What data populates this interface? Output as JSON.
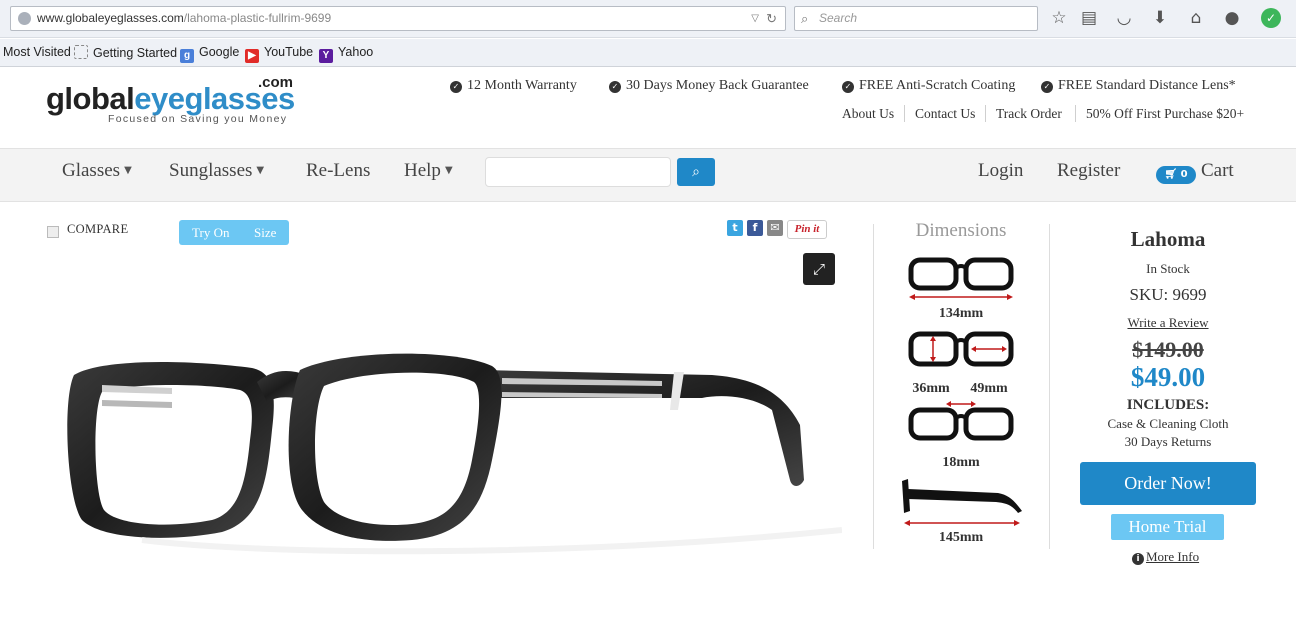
{
  "browser": {
    "url_host": "www.globaleyeglasses.com",
    "url_path": "/lahoma-plastic-fullrim-9699",
    "search_placeholder": "Search",
    "bookmarks": [
      {
        "label": "Most Visited",
        "icon": "none"
      },
      {
        "label": "Getting Started",
        "icon": "dashed-page-icon"
      },
      {
        "label": "Google",
        "icon": "google-icon"
      },
      {
        "label": "YouTube",
        "icon": "youtube-icon"
      },
      {
        "label": "Yahoo",
        "icon": "yahoo-icon"
      }
    ]
  },
  "header": {
    "logo_part1": "global",
    "logo_part2": "eyeglasses",
    "logo_com": ".com",
    "tagline": "Focused on Saving you Money",
    "perks": [
      "12 Month Warranty",
      "30 Days Money Back Guarantee",
      "FREE Anti-Scratch Coating",
      "FREE Standard Distance Lens*"
    ],
    "links": [
      "About Us",
      "Contact Us",
      "Track Order",
      "50% Off First Purchase $20+"
    ]
  },
  "nav": {
    "glasses": "Glasses",
    "sunglasses": "Sunglasses",
    "relens": "Re-Lens",
    "help": "Help",
    "login": "Login",
    "register": "Register",
    "cart": "Cart",
    "cart_count": "0"
  },
  "product_view": {
    "compare": "COMPARE",
    "try_on": "Try On",
    "size": "Size",
    "pin_it": "Pin it"
  },
  "dimensions": {
    "title": "Dimensions",
    "width": "134mm",
    "lens_height": "36mm",
    "lens_width": "49mm",
    "bridge": "18mm",
    "temple": "145mm"
  },
  "product": {
    "name": "Lahoma",
    "stock": "In Stock",
    "sku": "SKU: 9699",
    "review": "Write a Review",
    "old_price": "$149.00",
    "price": "$49.00",
    "includes_title": "INCLUDES:",
    "includes": [
      "Case & Cleaning Cloth",
      "30 Days Returns"
    ],
    "order_button": "Order Now!",
    "home_trial": "Home Trial",
    "more_info": "More Info"
  },
  "colors": {
    "brand_blue": "#1f88c8",
    "light_blue": "#6cc7f3"
  }
}
